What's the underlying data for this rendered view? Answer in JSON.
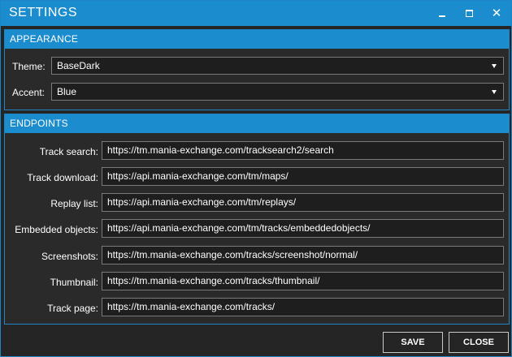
{
  "window": {
    "title": "SETTINGS",
    "controls": [
      "minimize-icon",
      "maximize-icon",
      "close-icon"
    ],
    "accent_color": "#1b8ccd",
    "background_color": "#252526"
  },
  "appearance": {
    "header": "APPEARANCE",
    "theme": {
      "label": "Theme:",
      "value": "BaseDark"
    },
    "accent": {
      "label": "Accent:",
      "value": "Blue"
    }
  },
  "endpoints": {
    "header": "ENDPOINTS",
    "items": [
      {
        "label": "Track search:",
        "value": "https://tm.mania-exchange.com/tracksearch2/search"
      },
      {
        "label": "Track download:",
        "value": "https://api.mania-exchange.com/tm/maps/"
      },
      {
        "label": "Replay list:",
        "value": "https://api.mania-exchange.com/tm/replays/"
      },
      {
        "label": "Embedded objects:",
        "value": "https://api.mania-exchange.com/tm/tracks/embeddedobjects/"
      },
      {
        "label": "Screenshots:",
        "value": "https://tm.mania-exchange.com/tracks/screenshot/normal/"
      },
      {
        "label": "Thumbnail:",
        "value": "https://tm.mania-exchange.com/tracks/thumbnail/"
      },
      {
        "label": "Track page:",
        "value": "https://tm.mania-exchange.com/tracks/"
      }
    ]
  },
  "footer": {
    "save_label": "SAVE",
    "close_label": "CLOSE"
  }
}
